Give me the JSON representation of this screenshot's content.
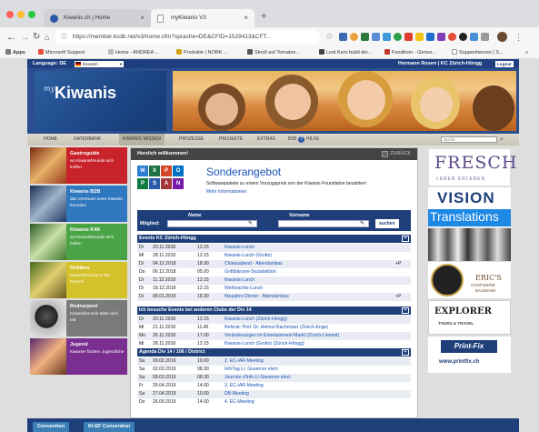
{
  "browser": {
    "tabs": [
      {
        "title": "Kiwanis.ch | Home",
        "icon": "globe-icon"
      },
      {
        "title": "myKiwanis V3",
        "icon": "document-icon"
      }
    ],
    "new_tab": "+",
    "url": "https://member.kcdb.net/v3/home.cfm?sprache=DE&CFID=1529413&CFT...",
    "bookmarks": [
      "Apps",
      "Microsoft Support",
      "Home - ANDREA ...",
      "Produkte | NORK ...",
      "Skroll auf Tomaton...",
      "Lost Kern build dio...",
      "Foodbom - Genus...",
      "Suppenheroes | S...",
      "»"
    ]
  },
  "site": {
    "lang_label": "Language: DE",
    "lang_value": "Deutsch",
    "user": "Hermann Rosen | KC Zürich-Höngg",
    "logout": "Logout",
    "logo_my": "my",
    "logo_name": "Kiwanis",
    "nav": [
      "HOME",
      "DATENBANK",
      "KIWANIS WISSEN",
      "PROZESSE",
      "PROJEKTE",
      "EXTRAS",
      "B2B",
      "HILFE"
    ],
    "nav_search": "Suche",
    "left_boxes": [
      {
        "title": "Gastroguide",
        "sub": "wo Kiwanisfreunde sich treffen",
        "color": "#c8232a"
      },
      {
        "title": "Kiwanis B2B",
        "sub": "das Vertrauen unter Kiwanis-freunden",
        "color": "#2f78bf"
      },
      {
        "title": "Kiwanis K4K",
        "sub": "wo Kiwanisfreunde sich helfen",
        "color": "#4aa447"
      },
      {
        "title": "Hobbies",
        "sub": "Kiwanisfreunde in der Freizeit",
        "color": "#d5c12b"
      },
      {
        "title": "Rednerpool",
        "sub": "Kiwanisfreunde teilen sich mit",
        "color": "#7a7a7a"
      },
      {
        "title": "Jugend",
        "sub": "Kiwanier fördern Jugendliche",
        "color": "#7a2e8f"
      }
    ],
    "welcome": "Herzlich willkommen!",
    "back": "ZURÜCK",
    "offer_title": "Sonderangebot",
    "offer_text": "Softwarepakete zu einem Vorzugspreis von der Kiwanis Foundation bezahlen!",
    "offer_link": "Mehr Informationen",
    "search_label": "Mitglied:",
    "name_label": "Name",
    "first_label": "Vorname",
    "search_button": "suchen",
    "section1": "Events KC Zürich-Höngg",
    "events1": [
      [
        "Di",
        "20.11.2018",
        "12.15",
        "Kiwanis-Lunch",
        ""
      ],
      [
        "Mi",
        "28.11.2018",
        "12.15",
        "Kiwanis-Lunch (Grotto)",
        ""
      ],
      [
        "Di",
        "04.12.2018",
        "18.30",
        "Chlausabend - Abendanlass",
        "+P"
      ],
      [
        "Do",
        "06.12.2018",
        "05.00",
        "Grittibänzen-Sozialaktion",
        ""
      ],
      [
        "Di",
        "11.12.2018",
        "12.15",
        "Kiwanis-Lunch",
        ""
      ],
      [
        "Di",
        "18.12.2018",
        "12.15",
        "Weihnachts-Lunch",
        ""
      ],
      [
        "Di",
        "08.01.2019",
        "18.30",
        "Neujahrs-Dinner - Abendanlass",
        "+P"
      ]
    ],
    "section2": "Ich besuche Events bei anderen Clubs der Div 14",
    "events2": [
      [
        "Di",
        "20.11.2018",
        "12.15",
        "Kiwanis-Lunch (Zürich-Höngg)",
        ""
      ],
      [
        "Mi",
        "21.11.2018",
        "11.45",
        "Referat: Prof. Dr. Helmut Bachmaier (Zürich-Enge)",
        ""
      ],
      [
        "Mo",
        "26.11.2018",
        "17.00",
        "Veränderungen im Entertainment Markt (Zürich-Limmat)",
        ""
      ],
      [
        "Mi",
        "28.11.2018",
        "12.15",
        "Kiwanis-Lunch (Grotto) (Zürich-Höngg)",
        ""
      ]
    ],
    "section3": "Agenda Div 14 / 106 / District",
    "events3": [
      [
        "Sa",
        "09.02.2019",
        "10.00",
        "2. EC-/AR-Meeting",
        ""
      ],
      [
        "Sa",
        "02.03.2019",
        "08.30",
        "InfoTag Lt. Governor elect",
        ""
      ],
      [
        "Sa",
        "09.03.2019",
        "08.30",
        "Journée d'Info Lt Governor elect",
        ""
      ],
      [
        "Fr",
        "26.04.2019",
        "14.00",
        "3. EC-/AR-Meeting",
        ""
      ],
      [
        "Sa",
        "27.04.2019",
        "10.00",
        "DB-Meeting",
        ""
      ],
      [
        "Do",
        "26.09.2019",
        "14.00",
        "4. EC-Meeting",
        ""
      ]
    ],
    "plus": "[+]",
    "ads": [
      {
        "lines": [
          "FRESCH",
          "LEBEN ERLEBEN"
        ]
      },
      {
        "lines": [
          "VISION",
          "Translations"
        ]
      },
      {
        "lines": []
      },
      {
        "lines": [
          "ERIC'S",
          "CONFISERIE",
          "BAUMANN"
        ]
      },
      {
        "lines": [
          "EXPLORER",
          "TOURS & TRAVEL"
        ]
      },
      {
        "lines": [
          "Print-Fix",
          "www.printfix.ch"
        ]
      }
    ],
    "bottom_tabs": [
      "Convention",
      "KI-EF Convention"
    ]
  },
  "colors": {
    "brand_blue": "#1e3f7a",
    "link": "#1a52b6"
  }
}
